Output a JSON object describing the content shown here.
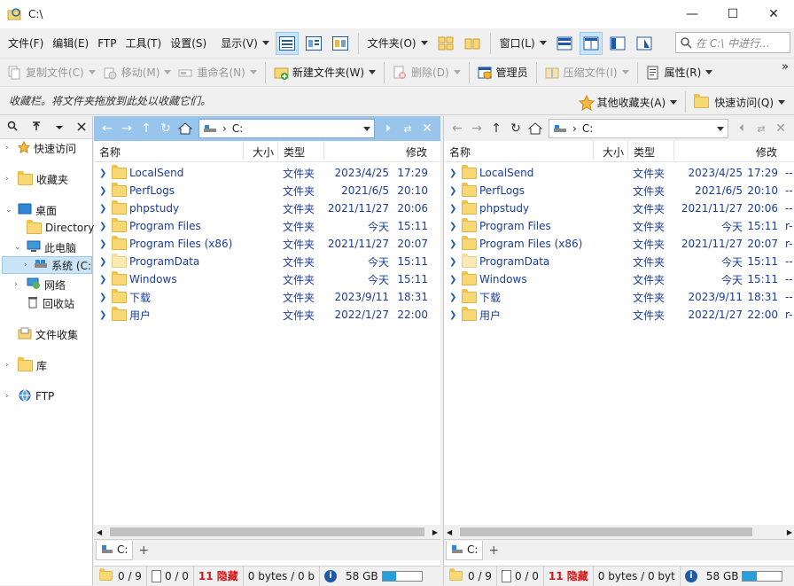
{
  "window": {
    "title": "C:\\",
    "minimize": "—",
    "maximize": "☐",
    "close": "✕"
  },
  "menu": {
    "file": "文件(F)",
    "edit": "编辑(E)",
    "ftp": "FTP",
    "tools": "工具(T)",
    "settings": "设置(S)",
    "view": "显示(V)",
    "folders": "文件夹(O)",
    "window_menu": "窗口(L)"
  },
  "search": {
    "placeholder": "在 C:\\ 中进行..."
  },
  "toolbar": {
    "copy": "复制文件(C)",
    "move": "移动(M)",
    "rename": "重命名(N)",
    "newfolder": "新建文件夹(W)",
    "delete": "删除(D)",
    "admin": "管理员",
    "compress": "压缩文件(I)",
    "properties": "属性(R)"
  },
  "favbar": {
    "hint": "收藏栏。将文件夹拖放到此处以收藏它们。",
    "other": "其他收藏夹(A)",
    "quick": "快速访问(Q)"
  },
  "tree": {
    "quick": "快速访问",
    "favorites": "收藏夹",
    "desktop": "桌面",
    "directory": "Directory",
    "thispc": "此电脑",
    "system": "系统 (C:",
    "network": "网络",
    "recycle": "回收站",
    "collect": "文件收集",
    "library": "库",
    "ftp": "FTP"
  },
  "left": {
    "path": "C:",
    "cols": {
      "name": "名称",
      "size": "大小",
      "type": "类型",
      "modified": "修改"
    },
    "rows": [
      {
        "name": "LocalSend",
        "type": "文件夹",
        "date": "2023/4/25",
        "time": "17:29"
      },
      {
        "name": "PerfLogs",
        "type": "文件夹",
        "date": "2021/6/5",
        "time": "20:10"
      },
      {
        "name": "phpstudy",
        "type": "文件夹",
        "date": "2021/11/27",
        "time": "20:06"
      },
      {
        "name": "Program Files",
        "type": "文件夹",
        "date": "今天",
        "time": "15:11"
      },
      {
        "name": "Program Files (x86)",
        "type": "文件夹",
        "date": "2021/11/27",
        "time": "20:07"
      },
      {
        "name": "ProgramData",
        "type": "文件夹",
        "date": "今天",
        "time": "15:11"
      },
      {
        "name": "Windows",
        "type": "文件夹",
        "date": "今天",
        "time": "15:11"
      },
      {
        "name": "下载",
        "type": "文件夹",
        "date": "2023/9/11",
        "time": "18:31"
      },
      {
        "name": "用户",
        "type": "文件夹",
        "date": "2022/1/27",
        "time": "22:00"
      }
    ],
    "tab": "C:",
    "status": {
      "folders": "0 / 9",
      "files": "0 / 0",
      "hidden": "11 隐藏",
      "bytes": "0 bytes / 0 b",
      "free": "58 GB",
      "disk_used": 0.35
    }
  },
  "right": {
    "path": "C:",
    "cols": {
      "name": "名称",
      "size": "大小",
      "type": "类型",
      "modified": "修改"
    },
    "rows": [
      {
        "name": "LocalSend",
        "type": "文件夹",
        "date": "2023/4/25",
        "time": "17:29",
        "extra": "--"
      },
      {
        "name": "PerfLogs",
        "type": "文件夹",
        "date": "2021/6/5",
        "time": "20:10",
        "extra": "--"
      },
      {
        "name": "phpstudy",
        "type": "文件夹",
        "date": "2021/11/27",
        "time": "20:06",
        "extra": "--"
      },
      {
        "name": "Program Files",
        "type": "文件夹",
        "date": "今天",
        "time": "15:11",
        "extra": "r-"
      },
      {
        "name": "Program Files (x86)",
        "type": "文件夹",
        "date": "2021/11/27",
        "time": "20:07",
        "extra": "r-"
      },
      {
        "name": "ProgramData",
        "type": "文件夹",
        "date": "今天",
        "time": "15:11",
        "extra": "--"
      },
      {
        "name": "Windows",
        "type": "文件夹",
        "date": "今天",
        "time": "15:11",
        "extra": "--"
      },
      {
        "name": "下载",
        "type": "文件夹",
        "date": "2023/9/11",
        "time": "18:31",
        "extra": "--"
      },
      {
        "name": "用户",
        "type": "文件夹",
        "date": "2022/1/27",
        "time": "22:00",
        "extra": "r-"
      }
    ],
    "tab": "C:",
    "status": {
      "folders": "0 / 9",
      "files": "0 / 0",
      "hidden": "11 隐藏",
      "bytes": "0 bytes / 0 byt",
      "free": "58 GB",
      "disk_used": 0.35
    }
  }
}
